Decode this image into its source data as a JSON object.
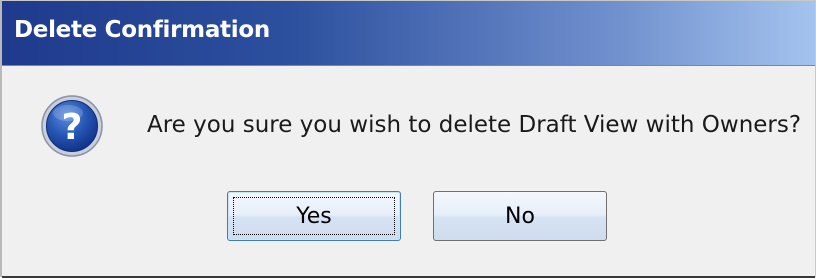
{
  "dialog": {
    "title": "Delete Confirmation",
    "icon": "question-icon",
    "message": "Are you sure you wish to delete Draft View with Owners?",
    "buttons": {
      "yes_label": "Yes",
      "no_label": "No"
    },
    "colors": {
      "titlebar_start": "#1f3a8c",
      "titlebar_end": "#a5c3ee",
      "icon_blue": "#1f4fa8"
    }
  }
}
